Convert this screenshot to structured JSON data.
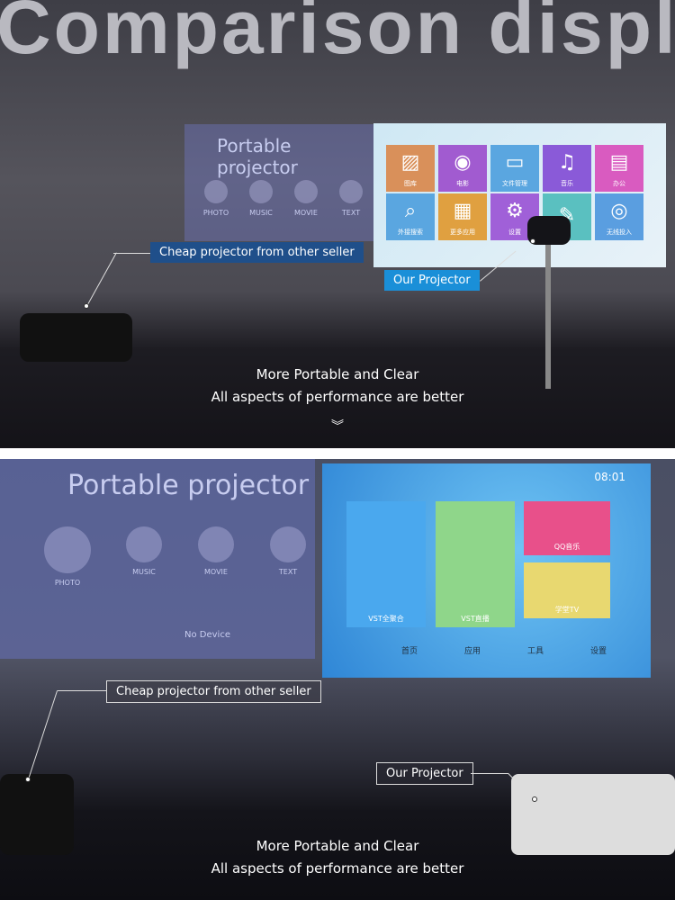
{
  "heading": "Comparison display",
  "top": {
    "cheap_screen": {
      "title": "Portable projector",
      "items": [
        "PHOTO",
        "MUSIC",
        "MOVIE",
        "TEXT"
      ]
    },
    "our_screen": {
      "tiles": [
        {
          "label": "图库",
          "color": "#d9905a",
          "icon": "photo-icon"
        },
        {
          "label": "电影",
          "color": "#a15bd0",
          "icon": "film-reel-icon"
        },
        {
          "label": "文件管理",
          "color": "#5aa6e0",
          "icon": "folder-icon"
        },
        {
          "label": "音乐",
          "color": "#8a5ad8",
          "icon": "music-note-icon"
        },
        {
          "label": "办公",
          "color": "#d95bc0",
          "icon": "document-icon"
        },
        {
          "label": "外接搜索",
          "color": "#5aa6e0",
          "icon": "search-icon"
        },
        {
          "label": "更多应用",
          "color": "#e0a040",
          "icon": "grid-icon"
        },
        {
          "label": "设置",
          "color": "#a060d8",
          "icon": "gear-icon"
        },
        {
          "label": "",
          "color": "#5ac0c0",
          "icon": "tools-icon"
        },
        {
          "label": "无线投入",
          "color": "#5a9ee0",
          "icon": "wireless-icon"
        }
      ]
    },
    "cheap_label": "Cheap projector from other seller",
    "our_label": "Our Projector",
    "caption_line1": "More Portable and Clear",
    "caption_line2": "All aspects of performance are better",
    "accent": "#1a8fd8"
  },
  "bottom": {
    "cheap_screen": {
      "title": "Portable projector",
      "items": [
        "PHOTO",
        "MUSIC",
        "MOVIE",
        "TEXT"
      ],
      "no_device": "No Device"
    },
    "our_screen": {
      "time": "08:01",
      "tiles": [
        {
          "label": "VST全聚合",
          "color": "#4aa8ee"
        },
        {
          "label": "VST直播",
          "color": "#8fd68a"
        },
        {
          "label": "QQ音乐",
          "color": "#e8508a"
        },
        {
          "label": "学堂TV",
          "color": "#e8d870"
        }
      ],
      "nav": [
        "首页",
        "应用",
        "工具",
        "设置"
      ]
    },
    "cheap_label": "Cheap projector from other seller",
    "our_label": "Our Projector",
    "caption_line1": "More Portable and Clear",
    "caption_line2": "All aspects of performance are better"
  }
}
